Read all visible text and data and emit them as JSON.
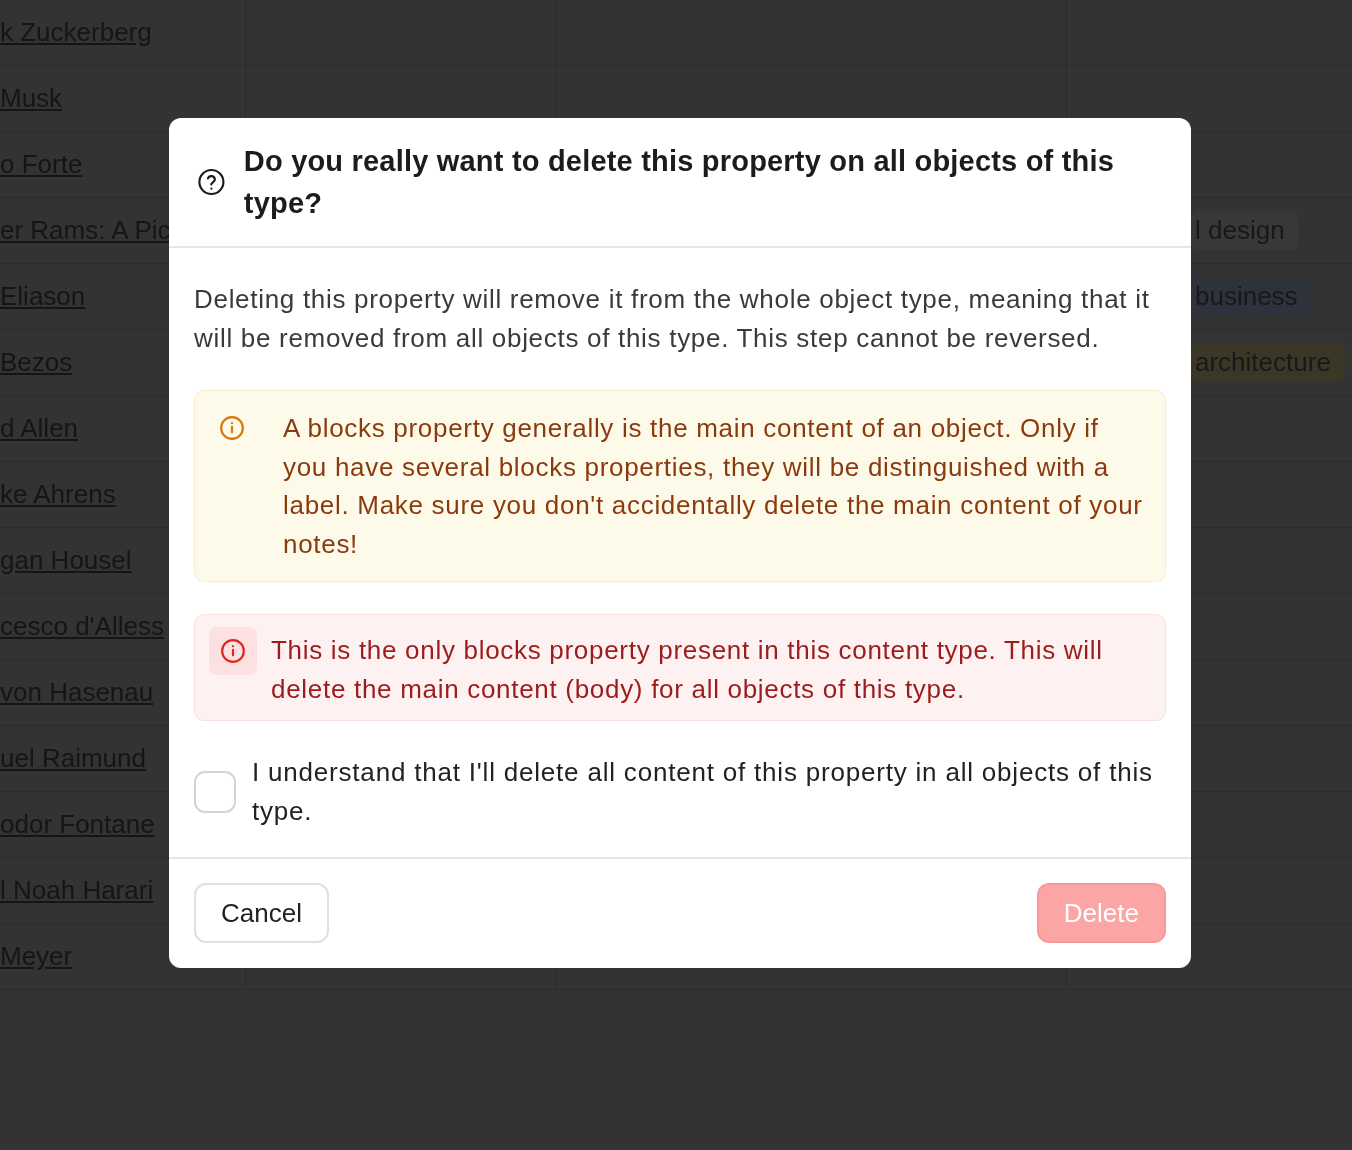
{
  "background_table": {
    "rows": [
      {
        "name": "k Zuckerberg"
      },
      {
        "name": "Musk"
      },
      {
        "name": "o Forte"
      },
      {
        "name": "er Rams: A Pic",
        "tag": {
          "label": "l design",
          "color": "#383838"
        }
      },
      {
        "name": "Eliason",
        "tag": {
          "label": "business",
          "color": "#2e323b"
        }
      },
      {
        "name": "Bezos",
        "tag": {
          "label": "architecture",
          "color": "#3b3727"
        }
      },
      {
        "name": "d Allen"
      },
      {
        "name": "ke Ahrens"
      },
      {
        "name": "gan Housel"
      },
      {
        "name": "cesco d'Alless"
      },
      {
        "name": "von Hasenau"
      },
      {
        "name": "uel Raimund"
      },
      {
        "name": "odor Fontane"
      },
      {
        "name": "l Noah Harari"
      },
      {
        "name": "Meyer"
      }
    ]
  },
  "dialog": {
    "title": "Do you really want to delete this property on all objects of this type?",
    "description": "Deleting this property will remove it from the whole object type, meaning that it will be removed from all objects of this type. This step cannot be reversed.",
    "alerts": [
      {
        "kind": "warning",
        "text": "A blocks property generally is the main content of an object. Only if you have several blocks properties, they will be distinguished with a label. Make sure you don't accidentally delete the main content of your notes!"
      },
      {
        "kind": "error",
        "text": "This is the only blocks property present in this content type. This will delete the main content (body) for all objects of this type."
      }
    ],
    "confirm": {
      "label": "I understand that I'll delete all content of this property in all objects of this type.",
      "checked": false
    },
    "cancel_button": "Cancel",
    "delete_button": {
      "label": "Delete",
      "disabled": true
    }
  }
}
